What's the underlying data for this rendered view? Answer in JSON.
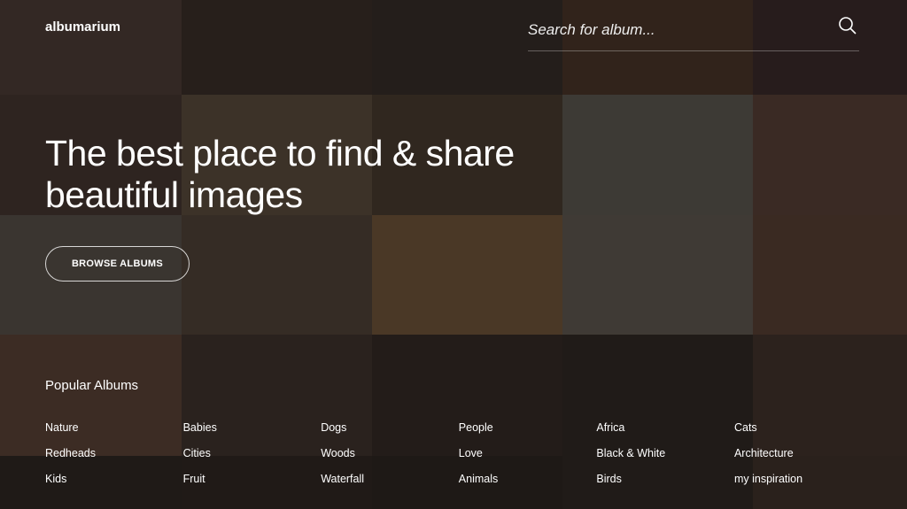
{
  "header": {
    "logo": "albumarium",
    "search_placeholder": "Search for album..."
  },
  "hero": {
    "title": "The best place to find & share beautiful images",
    "browse_label": "BROWSE ALBUMS"
  },
  "popular": {
    "heading": "Popular Albums",
    "albums": [
      "Nature",
      "Babies",
      "Dogs",
      "People",
      "Africa",
      "Cats",
      "Redheads",
      "Cities",
      "Woods",
      "Love",
      "Black & White",
      "Architecture",
      "Kids",
      "Fruit",
      "Waterfall",
      "Animals",
      "Birds",
      "my inspiration"
    ]
  },
  "tile_colors": [
    "#3d302b",
    "#2e2520",
    "#2b2420",
    "#3a2a20",
    "#2e2222",
    "#2e2420",
    "#3c3228",
    "#30271f",
    "#3d3a35",
    "#3a2a24",
    "#3a3530",
    "#352c25",
    "#4a3826",
    "#3f3a35",
    "#3a2a22",
    "#3c2c24",
    "#2a221e",
    "#231c19",
    "#201b18",
    "#2c221d",
    "#1f1a17",
    "#201a17",
    "#1e1916",
    "#201b18",
    "#2a211c"
  ]
}
